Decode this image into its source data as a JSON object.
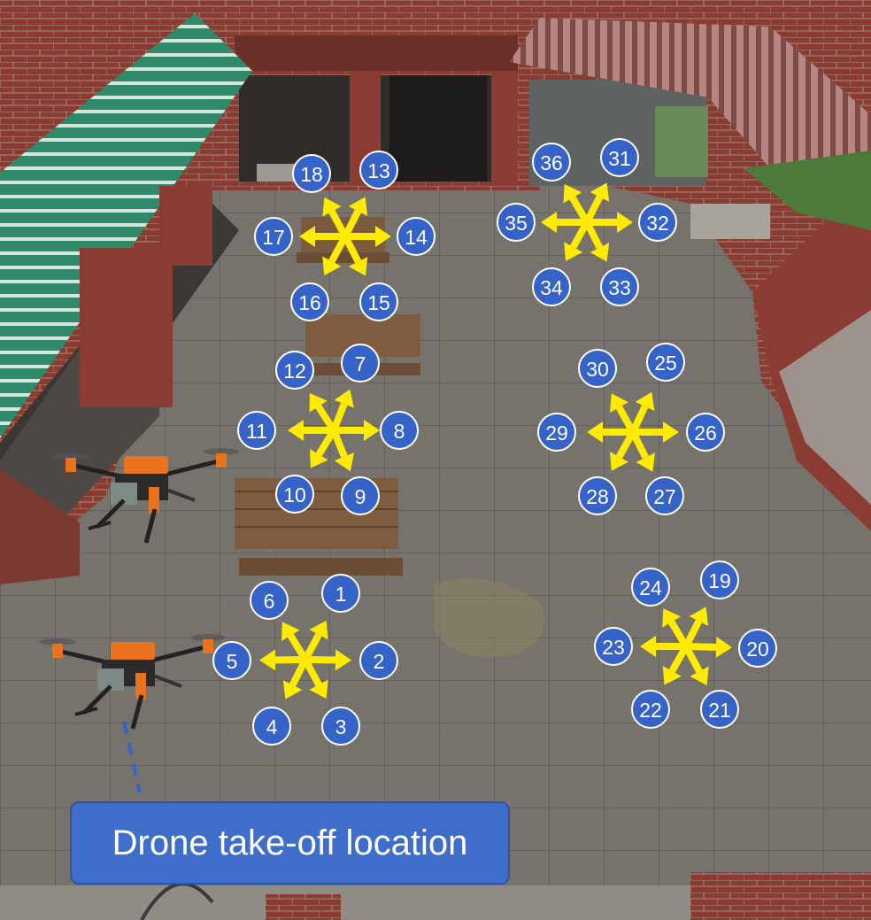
{
  "takeoff_label": "Drone take-off location",
  "colors": {
    "marker_fill": "#3563c8",
    "marker_stroke": "#ffffff",
    "arrow": "#ffea00",
    "label_bg": "#3e6ec9",
    "awning_green": "#2e8a68",
    "awning_red": "#8f5a55",
    "brick": "#8a3c32",
    "drone_orange": "#e8731c"
  },
  "positions": {
    "group_1": [
      "1",
      "2",
      "3",
      "4",
      "5",
      "6"
    ],
    "group_2": [
      "7",
      "8",
      "9",
      "10",
      "11",
      "12"
    ],
    "group_3": [
      "13",
      "14",
      "15",
      "16",
      "17",
      "18"
    ],
    "group_4": [
      "19",
      "20",
      "21",
      "22",
      "23",
      "24"
    ],
    "group_5": [
      "25",
      "26",
      "27",
      "28",
      "29",
      "30"
    ],
    "group_6": [
      "31",
      "32",
      "33",
      "34",
      "35",
      "36"
    ]
  }
}
